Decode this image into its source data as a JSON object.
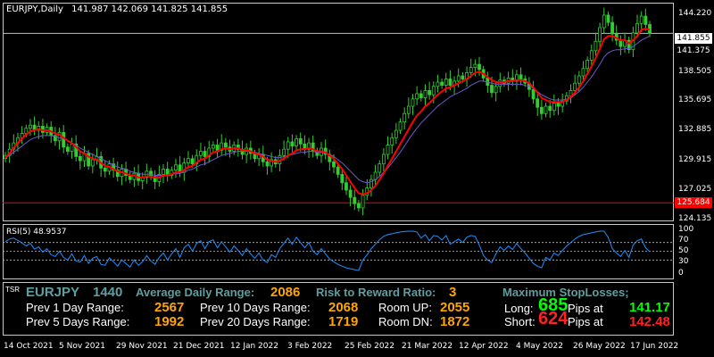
{
  "colors": {
    "bull": "#32CD32",
    "bear": "#32CD32",
    "ma_fast": "#FF0000",
    "ma_slow": "#6A5ACD",
    "rsi": "#1E90FF",
    "level_line": "#C0C0C0",
    "red_level": "#FF0000",
    "teal": "#5F9EA0",
    "orange": "#FFA500",
    "green": "#00FF00",
    "red": "#FF2020"
  },
  "header": {
    "symbol_tf": "EURJPY,Daily",
    "ohlc": "141.987 142.069 141.825 141.855"
  },
  "price_axis": {
    "labels": [
      "144.220",
      "138.505",
      "135.695",
      "132.885",
      "129.915",
      "127.025",
      "124.135"
    ],
    "current_price": "141.855",
    "hidden_label": "141.375",
    "red_level": "125.684"
  },
  "rsi": {
    "title": "RSI(5) 48.9537",
    "levels": [
      "100",
      "70",
      "50",
      "30",
      "0"
    ]
  },
  "dates": [
    "14 Oct 2021",
    "5 Nov 2021",
    "29 Nov 2021",
    "21 Dec 2021",
    "12 Jan 2022",
    "3 Feb 2022",
    "25 Feb 2022",
    "21 Mar 2022",
    "12 Apr 2022",
    "4 May 2022",
    "26 May 2022",
    "17 Jun 2022"
  ],
  "tsr": {
    "tag": "TSR",
    "symbol": "EURJPY",
    "period": "1440",
    "adr_label": "Average Daily Range:",
    "adr_value": "2086",
    "rr_label": "Risk to Reward Ratio:",
    "rr_value": "3",
    "max_sl_label": "Maximum StopLosses;",
    "prev1_label": "Prev 1 Day Range:",
    "prev1_value": "2567",
    "prev10_label": "Prev 10 Days Range:",
    "prev10_value": "2068",
    "room_up_label": "Room UP:",
    "room_up_value": "2055",
    "prev5_label": "Prev 5 Days Range:",
    "prev5_value": "1992",
    "prev20_label": "Prev 20 Days Range:",
    "prev20_value": "1719",
    "room_dn_label": "Room DN:",
    "room_dn_value": "1872",
    "long_label": "Long:",
    "long_pips": "685",
    "pips_at_label": "Pips at",
    "long_price": "141.17",
    "short_label": "Short:",
    "short_pips": "624",
    "short_price": "142.48"
  },
  "chart_data": {
    "type": "candlestick",
    "ylim": [
      124.0,
      144.7
    ],
    "rsi_ylim": [
      0,
      100
    ],
    "close": [
      130.2,
      130.8,
      131.4,
      131.9,
      132.3,
      132.8,
      133.1,
      132.6,
      133.0,
      132.4,
      132.9,
      132.1,
      131.6,
      132.4,
      131.0,
      130.6,
      131.3,
      130.1,
      129.7,
      130.4,
      129.2,
      129.8,
      130.1,
      129.0,
      128.7,
      129.4,
      128.8,
      128.2,
      128.9,
      128.3,
      127.9,
      128.5,
      127.8,
      128.1,
      128.7,
      128.2,
      127.7,
      128.4,
      128.9,
      128.3,
      128.8,
      129.3,
      128.6,
      129.5,
      129.9,
      129.4,
      130.2,
      130.6,
      130.1,
      130.9,
      131.2,
      130.7,
      131.4,
      131.0,
      130.6,
      131.2,
      130.8,
      130.3,
      130.9,
      130.4,
      129.9,
      130.3,
      129.6,
      129.2,
      129.8,
      129.4,
      130.2,
      130.8,
      131.5,
      131.1,
      131.8,
      131.3,
      130.8,
      131.4,
      130.6,
      130.2,
      130.9,
      130.3,
      129.6,
      129.1,
      128.4,
      127.6,
      126.9,
      126.2,
      125.6,
      125.2,
      126.4,
      127.1,
      127.9,
      128.6,
      129.4,
      130.3,
      131.2,
      131.9,
      132.6,
      133.4,
      134.2,
      134.9,
      135.6,
      136.1,
      135.7,
      136.4,
      136.0,
      136.8,
      137.2,
      136.9,
      137.5,
      136.9,
      137.3,
      137.8,
      137.5,
      138.1,
      138.6,
      138.9,
      138.4,
      137.6,
      136.9,
      136.2,
      136.8,
      137.4,
      137.1,
      137.6,
      137.3,
      137.9,
      137.5,
      137.1,
      136.5,
      135.6,
      134.8,
      134.2,
      134.9,
      134.5,
      135.2,
      134.9,
      135.4,
      135.9,
      136.4,
      137.1,
      137.8,
      138.5,
      139.3,
      140.2,
      141.1,
      142.4,
      143.6,
      142.9,
      141.8,
      141.2,
      140.6,
      141.2,
      140.3,
      141.9,
      142.8,
      143.5,
      142.7,
      141.855
    ],
    "ma_fast": [
      130.0,
      130.4,
      130.9,
      131.4,
      131.8,
      132.2,
      132.5,
      132.6,
      132.7,
      132.6,
      132.6,
      132.5,
      132.3,
      132.2,
      131.9,
      131.6,
      131.4,
      131.0,
      130.6,
      130.4,
      130.1,
      129.9,
      129.8,
      129.5,
      129.2,
      129.1,
      128.9,
      128.7,
      128.6,
      128.5,
      128.3,
      128.3,
      128.1,
      128.1,
      128.2,
      128.2,
      128.1,
      128.1,
      128.3,
      128.3,
      128.4,
      128.6,
      128.6,
      128.8,
      129.1,
      129.2,
      129.5,
      129.8,
      129.9,
      130.2,
      130.5,
      130.6,
      130.8,
      130.9,
      130.8,
      130.9,
      130.9,
      130.7,
      130.7,
      130.6,
      130.4,
      130.3,
      130.1,
      129.8,
      129.7,
      129.6,
      129.7,
      129.9,
      130.2,
      130.4,
      130.7,
      130.8,
      130.8,
      130.9,
      130.8,
      130.6,
      130.6,
      130.5,
      130.2,
      129.9,
      129.4,
      128.9,
      128.3,
      127.7,
      127.1,
      126.6,
      126.5,
      126.6,
      126.9,
      127.3,
      127.9,
      128.5,
      129.2,
      129.9,
      130.6,
      131.3,
      132.0,
      132.7,
      133.4,
      134.0,
      134.4,
      134.9,
      135.2,
      135.6,
      136.0,
      136.3,
      136.6,
      136.7,
      136.9,
      137.1,
      137.3,
      137.5,
      137.8,
      138.1,
      138.2,
      138.0,
      137.7,
      137.4,
      137.2,
      137.2,
      137.2,
      137.3,
      137.3,
      137.4,
      137.4,
      137.3,
      137.1,
      136.7,
      136.2,
      135.7,
      135.5,
      135.3,
      135.3,
      135.3,
      135.3,
      135.5,
      135.8,
      136.2,
      136.7,
      137.3,
      138.0,
      138.7,
      139.5,
      140.4,
      141.3,
      141.6,
      141.6,
      141.4,
      141.2,
      141.2,
      140.9,
      141.2,
      141.6,
      142.2,
      142.3,
      142.2
    ],
    "ma_slow": [
      130.0,
      130.2,
      130.5,
      130.8,
      131.1,
      131.4,
      131.7,
      131.9,
      132.0,
      132.1,
      132.1,
      132.1,
      132.0,
      131.9,
      131.8,
      131.6,
      131.4,
      131.2,
      130.9,
      130.7,
      130.5,
      130.3,
      130.1,
      129.9,
      129.7,
      129.5,
      129.3,
      129.1,
      129.0,
      128.9,
      128.7,
      128.6,
      128.5,
      128.4,
      128.4,
      128.4,
      128.3,
      128.3,
      128.3,
      128.3,
      128.4,
      128.5,
      128.5,
      128.6,
      128.8,
      128.9,
      129.1,
      129.3,
      129.4,
      129.6,
      129.8,
      130.0,
      130.2,
      130.3,
      130.4,
      130.5,
      130.6,
      130.6,
      130.6,
      130.6,
      130.5,
      130.4,
      130.3,
      130.2,
      130.1,
      130.0,
      130.0,
      130.1,
      130.2,
      130.3,
      130.4,
      130.5,
      130.5,
      130.6,
      130.6,
      130.5,
      130.5,
      130.4,
      130.3,
      130.1,
      129.8,
      129.5,
      129.1,
      128.7,
      128.3,
      127.9,
      127.7,
      127.6,
      127.7,
      127.9,
      128.2,
      128.6,
      129.0,
      129.5,
      130.0,
      130.5,
      131.1,
      131.7,
      132.3,
      132.8,
      133.3,
      133.7,
      134.1,
      134.5,
      134.9,
      135.2,
      135.5,
      135.8,
      136.0,
      136.2,
      136.4,
      136.6,
      136.9,
      137.1,
      137.3,
      137.3,
      137.2,
      137.1,
      137.0,
      137.0,
      137.0,
      137.0,
      137.0,
      137.0,
      137.0,
      136.9,
      136.8,
      136.6,
      136.3,
      136.0,
      135.8,
      135.6,
      135.5,
      135.5,
      135.5,
      135.6,
      135.7,
      136.0,
      136.3,
      136.7,
      137.2,
      137.7,
      138.3,
      138.9,
      139.6,
      140.0,
      140.2,
      140.3,
      140.3,
      140.4,
      140.4,
      140.6,
      140.9,
      141.2,
      141.4,
      141.6
    ],
    "rsi": [
      72,
      78,
      80,
      75,
      69,
      62,
      68,
      55,
      60,
      48,
      56,
      42,
      38,
      50,
      36,
      30,
      44,
      28,
      25,
      40,
      22,
      34,
      38,
      20,
      18,
      35,
      26,
      16,
      30,
      22,
      14,
      30,
      18,
      26,
      40,
      28,
      20,
      36,
      46,
      30,
      44,
      56,
      36,
      58,
      66,
      50,
      68,
      74,
      56,
      72,
      76,
      58,
      72,
      60,
      48,
      62,
      52,
      40,
      56,
      44,
      34,
      46,
      30,
      24,
      42,
      36,
      56,
      68,
      80,
      66,
      82,
      70,
      58,
      70,
      50,
      42,
      56,
      44,
      32,
      26,
      20,
      16,
      12,
      10,
      8,
      6,
      30,
      42,
      56,
      66,
      76,
      84,
      88,
      90,
      92,
      94,
      95,
      96,
      96,
      94,
      80,
      88,
      74,
      86,
      84,
      76,
      86,
      66,
      72,
      78,
      70,
      82,
      86,
      84,
      64,
      40,
      30,
      24,
      44,
      60,
      52,
      62,
      54,
      68,
      56,
      46,
      34,
      22,
      16,
      12,
      36,
      30,
      46,
      40,
      52,
      62,
      70,
      78,
      84,
      88,
      90,
      92,
      94,
      96,
      96,
      82,
      56,
      46,
      38,
      52,
      36,
      64,
      74,
      78,
      58,
      48.9537
    ]
  }
}
